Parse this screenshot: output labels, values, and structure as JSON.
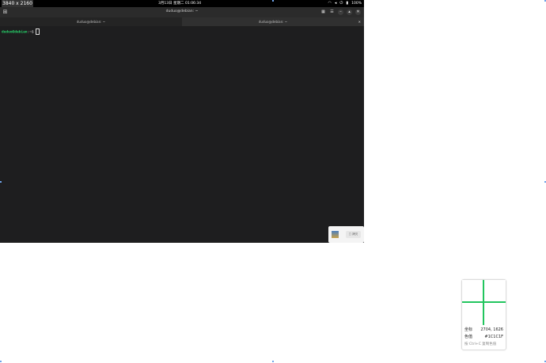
{
  "screen_size_label": "3840 x 2160",
  "topbar": {
    "clock": "3月13日 星期二  01:06:34",
    "tray": {
      "wifi_icon": "wifi-icon",
      "volume_icon": "volume-icon",
      "battery_icon": "battery-icon",
      "battery": "100%"
    }
  },
  "window": {
    "title": "duduo@debian: ~",
    "new_tab_icon": "⊞",
    "buttons": {
      "grid": "▦",
      "menu": "☰",
      "minimize": "–",
      "maximize": "▴",
      "close": "✕"
    }
  },
  "tabs": [
    {
      "label": "duduo@debian: ~"
    },
    {
      "label": "duduo@debian: ~",
      "close": "✕"
    }
  ],
  "terminal": {
    "prompt_user": "duduo@debian",
    "prompt_rest": ":~$ "
  },
  "notification": {
    "action_label": "□ 拷贝"
  },
  "picker": {
    "coord_label": "坐标",
    "coord_value": "2704, 1626",
    "color_label": "色值",
    "color_value": "#1C1C1F",
    "hint": "按 Ctrl+C 复制色值",
    "crosshair_color": "#22c55e"
  }
}
